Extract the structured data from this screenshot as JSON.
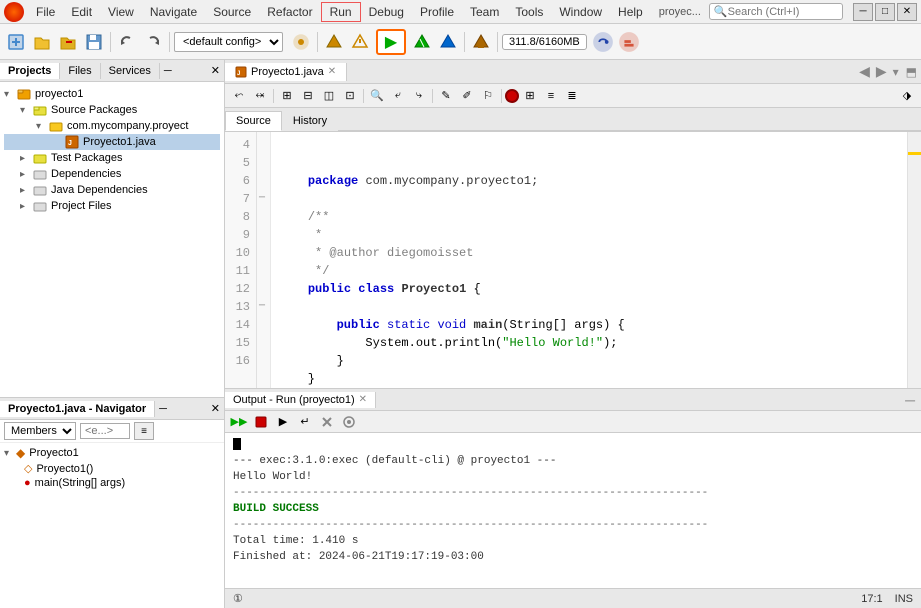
{
  "app": {
    "icon": "●",
    "title": "proyec..."
  },
  "menu": {
    "items": [
      "File",
      "Edit",
      "View",
      "Navigate",
      "Source",
      "Refactor",
      "Run",
      "Debug",
      "Profile",
      "Team",
      "Tools",
      "Window",
      "Help"
    ]
  },
  "toolbar": {
    "config": "<default config>",
    "memory": "311.8/6160MB",
    "search_placeholder": "Search (Ctrl+I)"
  },
  "left_panel": {
    "tabs": [
      "Projects",
      "Files",
      "Services"
    ],
    "project_tree": {
      "root": {
        "label": "proyecto1",
        "children": [
          {
            "label": "Source Packages",
            "type": "source_packages",
            "children": [
              {
                "label": "com.mycompany.proyect",
                "type": "package",
                "children": [
                  {
                    "label": "Proyecto1.java",
                    "type": "java",
                    "selected": true
                  }
                ]
              }
            ]
          },
          {
            "label": "Test Packages",
            "type": "folder"
          },
          {
            "label": "Dependencies",
            "type": "folder"
          },
          {
            "label": "Java Dependencies",
            "type": "folder"
          },
          {
            "label": "Project Files",
            "type": "folder"
          }
        ]
      }
    }
  },
  "navigator_panel": {
    "title": "Proyecto1.java - Navigator",
    "members_label": "Members",
    "filter_placeholder": "<e...>",
    "tree": [
      {
        "label": "Proyecto1",
        "type": "class"
      },
      {
        "label": "Proyecto1()",
        "type": "method",
        "indent": 1
      },
      {
        "label": "main(String[] args)",
        "type": "method",
        "indent": 1
      }
    ]
  },
  "editor": {
    "tab_name": "Proyecto1.java",
    "source_tab": "Source",
    "history_tab": "History",
    "lines": [
      {
        "num": 4,
        "content": "",
        "raw": ""
      },
      {
        "num": 5,
        "content": "    package com.mycompany.proyecto1;",
        "raw": "package"
      },
      {
        "num": 6,
        "content": "",
        "raw": ""
      },
      {
        "num": 7,
        "content": "    /**",
        "raw": "comment_start",
        "fold": true
      },
      {
        "num": 8,
        "content": "     *",
        "raw": "comment"
      },
      {
        "num": 9,
        "content": "     * @author diegomoisset",
        "raw": "comment"
      },
      {
        "num": 10,
        "content": "     */",
        "raw": "comment_end"
      },
      {
        "num": 11,
        "content": "    public class Proyecto1 {",
        "raw": "class"
      },
      {
        "num": 12,
        "content": "",
        "raw": ""
      },
      {
        "num": 13,
        "content": "        public static void main(String[] args) {",
        "raw": "method",
        "fold": true
      },
      {
        "num": 14,
        "content": "            System.out.println(\"Hello World!\");",
        "raw": "statement"
      },
      {
        "num": 15,
        "content": "        }",
        "raw": "close"
      },
      {
        "num": 16,
        "content": "    }",
        "raw": "close"
      }
    ]
  },
  "output": {
    "tab_name": "Output - Run (proyecto1)",
    "lines": [
      {
        "type": "normal",
        "text": "--- exec:3.1.0:exec (default-cli) @ proyecto1 ---"
      },
      {
        "type": "normal",
        "text": "Hello World!"
      },
      {
        "type": "separator",
        "text": "------------------------------------------------------------------------"
      },
      {
        "type": "success",
        "text": "BUILD SUCCESS"
      },
      {
        "type": "separator",
        "text": "------------------------------------------------------------------------"
      },
      {
        "type": "normal",
        "text": "Total time:  1.410 s"
      },
      {
        "type": "normal",
        "text": "Finished at: 2024-06-21T19:17:19-03:00"
      }
    ]
  },
  "status_bar": {
    "notification": "①",
    "position": "17:1",
    "mode": "INS"
  }
}
